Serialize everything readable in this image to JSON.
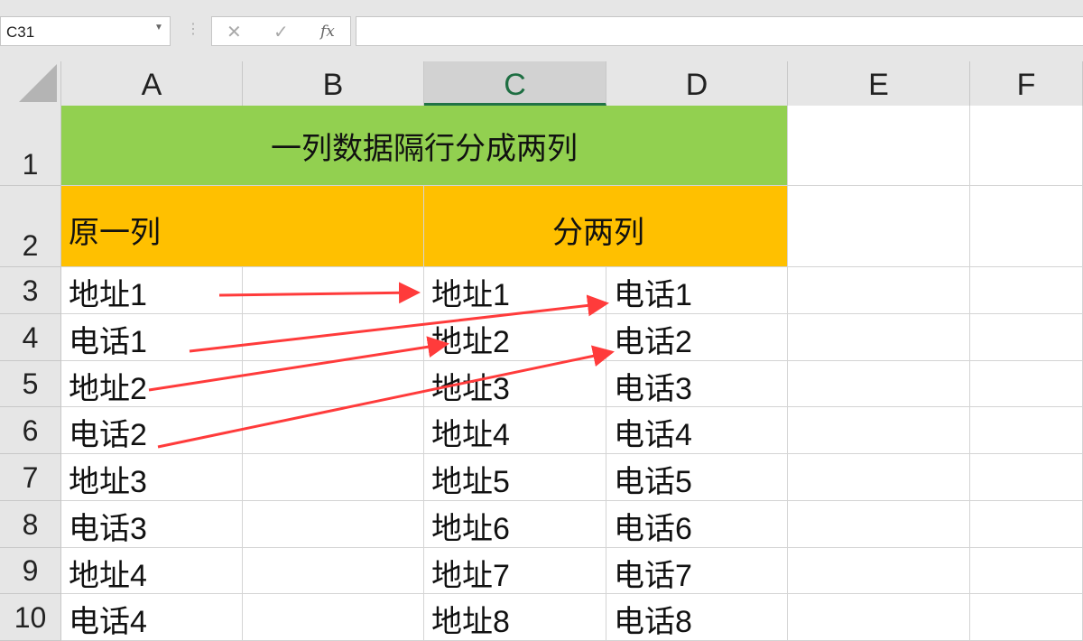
{
  "formula_bar": {
    "name_box": "C31",
    "cancel_icon": "✕",
    "enter_icon": "✓",
    "fx_label": "fx",
    "formula": ""
  },
  "columns": [
    "A",
    "B",
    "C",
    "D",
    "E",
    "F"
  ],
  "selected_column": "C",
  "rows": [
    "1",
    "2",
    "3",
    "4",
    "5",
    "6",
    "7",
    "8",
    "9",
    "10"
  ],
  "sheet": {
    "title": "一列数据隔行分成两列",
    "title_color": "#92d050",
    "header_color": "#ffc000",
    "header_left": "原一列",
    "header_right": "分两列",
    "col_a": [
      "地址1",
      "电话1",
      "地址2",
      "电话2",
      "地址3",
      "电话3",
      "地址4",
      "电话4"
    ],
    "col_c": [
      "地址1",
      "地址2",
      "地址3",
      "地址4",
      "地址5",
      "地址6",
      "地址7",
      "地址8"
    ],
    "col_d": [
      "电话1",
      "电话2",
      "电话3",
      "电话4",
      "电话5",
      "电话6",
      "电话7",
      "电话8"
    ]
  },
  "arrow_color": "#ff3b3b"
}
